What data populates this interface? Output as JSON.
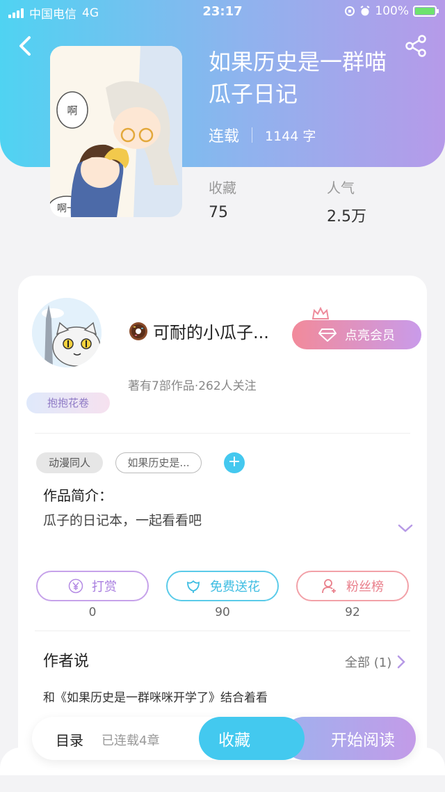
{
  "status_bar": {
    "carrier": "中国电信",
    "network": "4G",
    "time": "23:17",
    "battery": "100%"
  },
  "book": {
    "title_line1": "如果历史是一群喵",
    "title_line2": "瓜子日记",
    "status": "连载",
    "word_count": "1144 字",
    "favorites_label": "收藏",
    "favorites_value": "75",
    "popularity_label": "人气",
    "popularity_value": "2.5万",
    "cover_text_1": "啊",
    "cover_text_2": "啊一"
  },
  "author": {
    "name": "可耐的小瓜子...",
    "meta": "著有7部作品·262人关注",
    "badge": "抱抱花卷",
    "vip_button": "点亮会员"
  },
  "tags": {
    "category": "动漫同人",
    "series": "如果历史是...",
    "add": "+"
  },
  "intro": {
    "title": "作品简介：",
    "text": "瓜子的日记本，一起看看吧"
  },
  "actions": {
    "reward_label": "打赏",
    "reward_count": "0",
    "flower_label": "免费送花",
    "flower_count": "90",
    "fans_label": "粉丝榜",
    "fans_count": "92"
  },
  "author_says": {
    "title": "作者说",
    "all_label": "全部 (1)",
    "text": "和《如果历史是一群咪咪开学了》结合着看"
  },
  "bottom_bar": {
    "toc": "目录",
    "toc_sub": "已连载4章",
    "favorite": "收藏",
    "start_reading": "开始阅读"
  },
  "colors": {
    "accent_blue": "#43c9ef",
    "accent_purple": "#c39be8",
    "accent_pink": "#f28a9a"
  }
}
